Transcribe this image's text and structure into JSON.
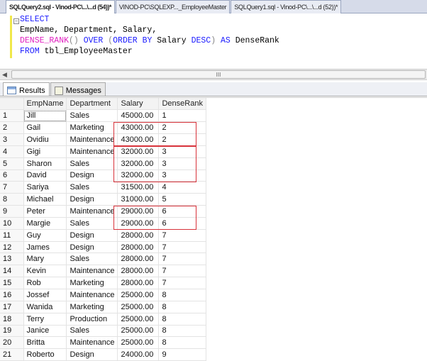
{
  "tabs": [
    "SQLQuery2.sql - Vinod-PC\\...\\...d (54))*",
    "VINOD-PC\\SQLEXP..._EmployeeMaster",
    "SQLQuery1.sql - Vinod-PC\\...\\...d (52))*"
  ],
  "editor": {
    "l1": "SELECT",
    "l2": "EmpName, Department, Salary,",
    "l3a": "DENSE_RANK",
    "l3b": "()",
    "l3c": " OVER ",
    "l3d": "(",
    "l3e": "ORDER BY",
    "l3f": " Salary ",
    "l3g": "DESC",
    "l3h": ")",
    "l3i": " AS ",
    "l3j": "DenseRank",
    "l4a": "FROM",
    "l4b": " tbl_EmployeeMaster"
  },
  "scroll_grip": "III",
  "result_tabs": [
    "Results",
    "Messages"
  ],
  "columns": [
    "",
    "EmpName",
    "Department",
    "Salary",
    "DenseRank"
  ],
  "rows": [
    [
      "1",
      "Jill",
      "Sales",
      "45000.00",
      "1"
    ],
    [
      "2",
      "Gail",
      "Marketing",
      "43000.00",
      "2"
    ],
    [
      "3",
      "Ovidiu",
      "Maintenance",
      "43000.00",
      "2"
    ],
    [
      "4",
      "Gigi",
      "Maintenance",
      "32000.00",
      "3"
    ],
    [
      "5",
      "Sharon",
      "Sales",
      "32000.00",
      "3"
    ],
    [
      "6",
      "David",
      "Design",
      "32000.00",
      "3"
    ],
    [
      "7",
      "Sariya",
      "Sales",
      "31500.00",
      "4"
    ],
    [
      "8",
      "Michael",
      "Design",
      "31000.00",
      "5"
    ],
    [
      "9",
      "Peter",
      "Maintenance",
      "29000.00",
      "6"
    ],
    [
      "10",
      "Margie",
      "Sales",
      "29000.00",
      "6"
    ],
    [
      "11",
      "Guy",
      "Design",
      "28000.00",
      "7"
    ],
    [
      "12",
      "James",
      "Design",
      "28000.00",
      "7"
    ],
    [
      "13",
      "Mary",
      "Sales",
      "28000.00",
      "7"
    ],
    [
      "14",
      "Kevin",
      "Maintenance",
      "28000.00",
      "7"
    ],
    [
      "15",
      "Rob",
      "Marketing",
      "28000.00",
      "7"
    ],
    [
      "16",
      "Jossef",
      "Maintenance",
      "25000.00",
      "8"
    ],
    [
      "17",
      "Wanida",
      "Marketing",
      "25000.00",
      "8"
    ],
    [
      "18",
      "Terry",
      "Production",
      "25000.00",
      "8"
    ],
    [
      "19",
      "Janice",
      "Sales",
      "25000.00",
      "8"
    ],
    [
      "20",
      "Britta",
      "Maintenance",
      "25000.00",
      "8"
    ],
    [
      "21",
      "Roberto",
      "Design",
      "24000.00",
      "9"
    ]
  ],
  "highlight_color": "#d8323a"
}
